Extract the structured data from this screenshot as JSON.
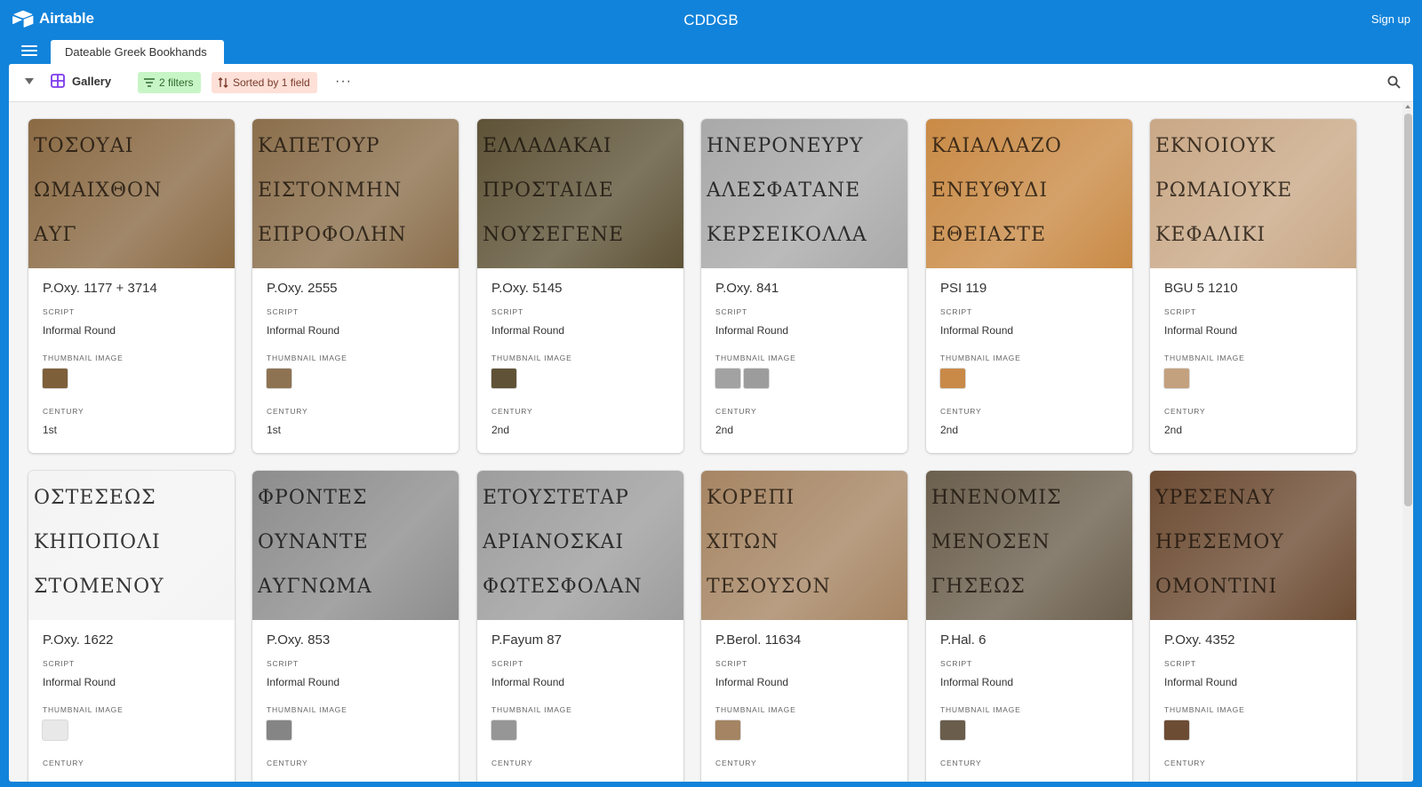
{
  "app": {
    "logo_text": "Airtable",
    "base_title": "CDDGB",
    "signup_label": "Sign up"
  },
  "tabs": [
    {
      "label": "Dateable Greek Bookhands"
    }
  ],
  "view": {
    "name": "Gallery",
    "filter_label": "2 filters",
    "sort_label": "Sorted by 1 field",
    "more_label": "···"
  },
  "field_labels": {
    "script": "SCRIPT",
    "thumbnail": "THUMBNAIL IMAGE",
    "century": "CENTURY"
  },
  "cards": [
    {
      "title": "P.Oxy. 1177 + 3714",
      "script": "Informal Round",
      "century": "1st",
      "cover_color": "#8a6a44",
      "ink": [
        "ΤΟΣΟΥΑΙ",
        "ΩΜΑΙΧΘΟΝ",
        "ΑΥΓ"
      ],
      "thumbs": [
        "#7d5f3a"
      ]
    },
    {
      "title": "P.Oxy. 2555",
      "script": "Informal Round",
      "century": "1st",
      "cover_color": "#8b6f4c",
      "ink": [
        "ΚΑΠΕΤΟΥΡ",
        "ΕΙΣΤΟΝΜΗΝ",
        "ΕΠΡΟΦΟΛΗΝ"
      ],
      "thumbs": [
        "#8e7352"
      ]
    },
    {
      "title": "P.Oxy. 5145",
      "script": "Informal Round",
      "century": "2nd",
      "cover_color": "#5e5337",
      "ink": [
        "ΕΛΛΑΔΑΚΑΙ",
        "ΠΡΟΣΤΑΙΔΕ",
        "ΝΟΥΣΕΓΕΝΕ"
      ],
      "thumbs": [
        "#5f5236"
      ]
    },
    {
      "title": "P.Oxy. 841",
      "script": "Informal Round",
      "century": "2nd",
      "cover_color": "#a9a9a9",
      "ink": [
        "ΗΝΕΡΟΝΕΥΡΥ",
        "ΑΛΕΣΦΑΤΑΝΕ",
        "ΚΕΡΣΕΙΚΟΛΛΑ"
      ],
      "thumbs": [
        "#a2a2a2",
        "#9c9c9c"
      ]
    },
    {
      "title": "PSI 119",
      "script": "Informal Round",
      "century": "2nd",
      "cover_color": "#c98a45",
      "ink": [
        "ΚΑΙΑΛΛΑΖΟ",
        "ΕΝΕΥΘΥΔΙ",
        "ΕΘΕΙΑΣΤΕ"
      ],
      "thumbs": [
        "#c98a48"
      ]
    },
    {
      "title": "BGU 5 1210",
      "script": "Informal Round",
      "century": "2nd",
      "cover_color": "#c9a886",
      "ink": [
        "ΕΚΝΟΙΟΥΚ",
        "ΡΩΜΑΙΟΥΚΕ",
        "ΚΕΦΑΛΙΚΙ"
      ],
      "thumbs": [
        "#c4a17e"
      ]
    },
    {
      "title": "P.Oxy. 1622",
      "script": "Informal Round",
      "century": "",
      "cover_color": "#f4f4f4",
      "ink": [
        "ΟΣΤΕΣΕΩΣ",
        "ΚΗΠΟΠΟΛΙ",
        "ΣΤΟΜΕΝΟΥ"
      ],
      "thumbs": [
        "#e8e8e8"
      ]
    },
    {
      "title": "P.Oxy. 853",
      "script": "Informal Round",
      "century": "",
      "cover_color": "#8d8d8d",
      "ink": [
        "ΦΡΟΝΤΕΣ",
        "ΟΥΝΑΝΤΕ",
        "ΑΥΓΝΩΜΑ"
      ],
      "thumbs": [
        "#858585"
      ]
    },
    {
      "title": "P.Fayum 87",
      "script": "Informal Round",
      "century": "",
      "cover_color": "#9d9d9d",
      "ink": [
        "ΕΤΟΥΣΤΕΤΑΡ",
        "ΑΡΙΑΝΟΣΚΑΙ",
        "ΦΩΤΕΣΦΟΛΑΝ"
      ],
      "thumbs": [
        "#969696"
      ]
    },
    {
      "title": "P.Berol. 11634",
      "script": "Informal Round",
      "century": "",
      "cover_color": "#a68563",
      "ink": [
        "ΚΟΡΕΠΙ",
        "ΧΙΤΩΝ",
        "ΤΕΣΟΥΣΟΝ"
      ],
      "thumbs": [
        "#a48462"
      ]
    },
    {
      "title": "P.Hal. 6",
      "script": "Informal Round",
      "century": "",
      "cover_color": "#6b5f4d",
      "ink": [
        "ΗΝΕΝΟΜΙΣ",
        "ΜΕΝΟΣΕΝ",
        "ΓΗΣΕΩΣ"
      ],
      "thumbs": [
        "#6a5d4c"
      ]
    },
    {
      "title": "P.Oxy. 4352",
      "script": "Informal Round",
      "century": "",
      "cover_color": "#6d4c33",
      "ink": [
        "ΥΡΕΣΕΝΑΥ",
        "ΗΡΕΣΕΜΟΥ",
        "ΟΜΟΝΤΙΝΙ"
      ],
      "thumbs": [
        "#6d4c34"
      ]
    }
  ]
}
